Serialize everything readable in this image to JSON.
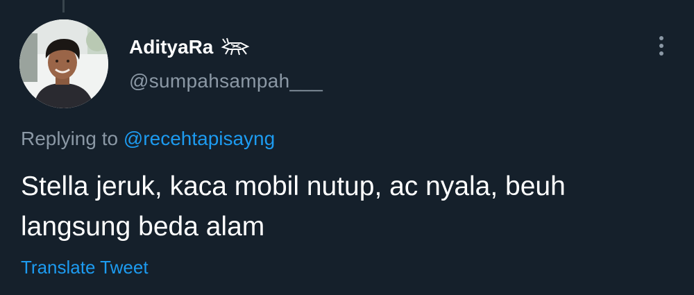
{
  "tweet": {
    "display_name": "AdityaRa",
    "name_emoji": "cricket-emoji",
    "handle": "@sumpahsampah___",
    "replying_prefix": "Replying to ",
    "replying_to": "@recehtapisayng",
    "text": "Stella jeruk, kaca mobil nutup, ac nyala, beuh langsung beda alam",
    "translate_label": "Translate Tweet",
    "more_icon": "more-vertical-icon"
  },
  "colors": {
    "background": "#15202b",
    "text_primary": "#ffffff",
    "text_secondary": "#8b98a5",
    "accent": "#1d9bf0"
  }
}
